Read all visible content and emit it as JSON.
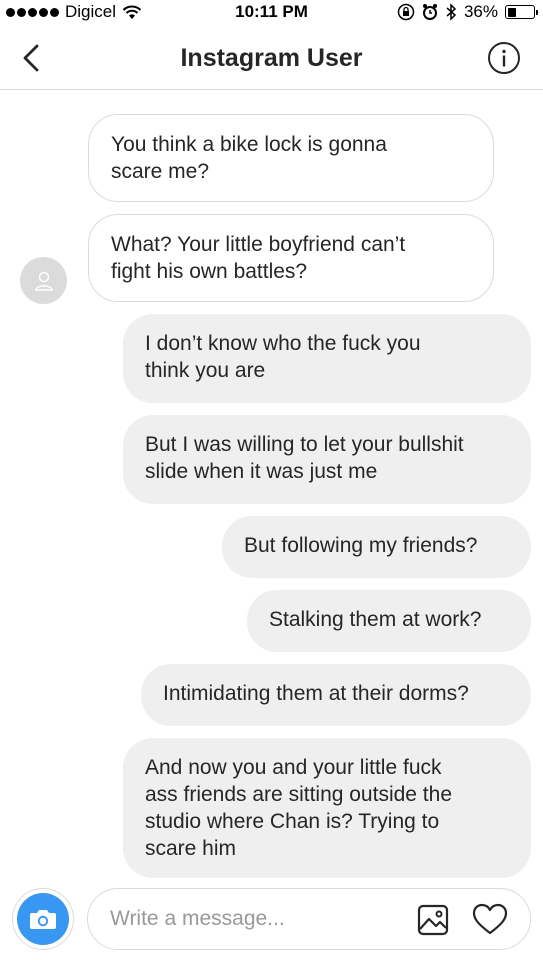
{
  "status_bar": {
    "carrier": "Digicel",
    "time": "10:11 PM",
    "battery": "36%",
    "battery_level": 0.36
  },
  "header": {
    "title": "Instagram User"
  },
  "messages": [
    {
      "sender": "them",
      "text": "You think a bike lock is gonna\nscare me?"
    },
    {
      "sender": "them",
      "text": "What? Your little boyfriend can’t\nfight his own battles?"
    },
    {
      "sender": "me",
      "text": "I don’t know who the fuck you\nthink you are"
    },
    {
      "sender": "me",
      "text": "But I was willing to let your bullshit\nslide when it was just me"
    },
    {
      "sender": "me",
      "text": "But following my friends?"
    },
    {
      "sender": "me",
      "text": "Stalking them at work?"
    },
    {
      "sender": "me",
      "text": "Intimidating them at their dorms?"
    },
    {
      "sender": "me",
      "text": "And now you and your little fuck\nass friends are sitting outside the\nstudio where Chan is? Trying to\nscare him"
    }
  ],
  "composer": {
    "placeholder": "Write a message..."
  },
  "icons": {
    "back": "chevron-left-icon",
    "info": "info-icon",
    "camera": "camera-icon",
    "gallery": "image-icon",
    "heart": "heart-icon",
    "avatar": "person-icon"
  },
  "colors": {
    "accent": "#3897f0",
    "outgoing_bubble": "#efefef",
    "border": "#dbdbdb"
  }
}
